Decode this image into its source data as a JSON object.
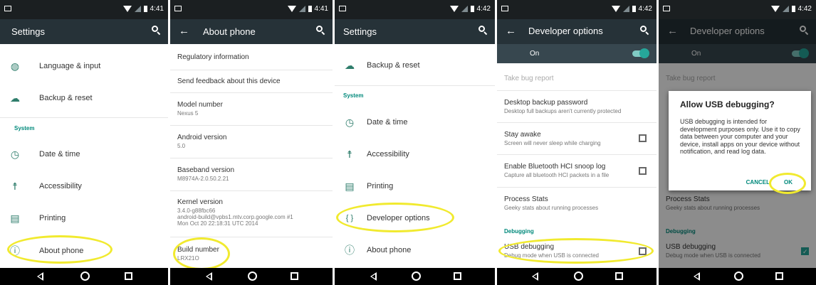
{
  "status_time": [
    "4:41",
    "4:41",
    "4:42",
    "4:42",
    "4:42"
  ],
  "colors": {
    "status_bar": "#1b1f21",
    "app_bar": "#263238",
    "accent": "#00897b",
    "highlight": "#f1ea2f"
  },
  "screen1": {
    "title": "Settings",
    "items_top": [
      {
        "icon": "globe-icon",
        "label": "Language & input"
      },
      {
        "icon": "cloud-backup-icon",
        "label": "Backup & reset"
      }
    ],
    "section": "System",
    "items_system": [
      {
        "icon": "clock-icon",
        "label": "Date & time"
      },
      {
        "icon": "accessibility-icon",
        "label": "Accessibility"
      },
      {
        "icon": "printer-icon",
        "label": "Printing"
      },
      {
        "icon": "info-icon",
        "label": "About phone"
      }
    ]
  },
  "screen2": {
    "title": "About phone",
    "items": [
      {
        "title": "Regulatory information",
        "subtitle": ""
      },
      {
        "title": "Send feedback about this device",
        "subtitle": ""
      },
      {
        "title": "Model number",
        "subtitle": "Nexus 5"
      },
      {
        "title": "Android version",
        "subtitle": "5.0"
      },
      {
        "title": "Baseband version",
        "subtitle": "M8974A-2.0.50.2.21"
      },
      {
        "title": "Kernel version",
        "subtitle": "3.4.0-g88fbc66",
        "subtitle2": "android-build@vpbs1.mtv.corp.google.com #1",
        "subtitle3": "Mon Oct 20 22:18:31 UTC 2014"
      },
      {
        "title": "Build number",
        "subtitle": "LRX21O"
      }
    ]
  },
  "screen3": {
    "title": "Settings",
    "items_top": [
      {
        "icon": "cloud-backup-icon",
        "label": "Backup & reset"
      }
    ],
    "section": "System",
    "items_system": [
      {
        "icon": "clock-icon",
        "label": "Date & time"
      },
      {
        "icon": "accessibility-icon",
        "label": "Accessibility"
      },
      {
        "icon": "printer-icon",
        "label": "Printing"
      },
      {
        "icon": "code-braces-icon",
        "label": "Developer options"
      },
      {
        "icon": "info-icon",
        "label": "About phone"
      }
    ]
  },
  "screen4": {
    "title": "Developer options",
    "on_label": "On",
    "take_bug_report": "Take bug report",
    "items": [
      {
        "title": "Desktop backup password",
        "subtitle": "Desktop full backups aren't currently protected"
      },
      {
        "title": "Stay awake",
        "subtitle": "Screen will never sleep while charging"
      },
      {
        "title": "Enable Bluetooth HCI snoop log",
        "subtitle": "Capture all bluetooth HCI packets in a file"
      },
      {
        "title": "Process Stats",
        "subtitle": "Geeky stats about running processes"
      }
    ],
    "section": "Debugging",
    "usb": {
      "title": "USB debugging",
      "subtitle": "Debug mode when USB is connected"
    }
  },
  "screen5": {
    "title": "Developer options",
    "on_label": "On",
    "take_bug_report": "Take bug report",
    "process_stats": {
      "title": "Process Stats",
      "subtitle": "Geeky stats about running processes"
    },
    "section": "Debugging",
    "usb": {
      "title": "USB debugging",
      "subtitle": "Debug mode when USB is connected"
    },
    "dialog": {
      "title": "Allow USB debugging?",
      "body": "USB debugging is intended for development purposes only. Use it to copy data between your computer and your device, install apps on your device without notification, and read log data.",
      "cancel": "CANCEL",
      "ok": "OK"
    }
  }
}
